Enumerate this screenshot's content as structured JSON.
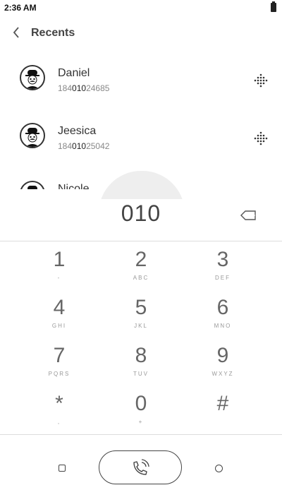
{
  "status_bar": {
    "time": "2:36 AM",
    "battery_icon": "battery-icon"
  },
  "header": {
    "title": "Recents",
    "back_icon": "back-arrow-icon"
  },
  "recents": [
    {
      "name": "Daniel",
      "number_prefix": "184",
      "number_match": "010",
      "number_suffix": "24685"
    },
    {
      "name": "Jeesica",
      "number_prefix": "184",
      "number_match": "010",
      "number_suffix": "25042"
    },
    {
      "name": "Nicole"
    }
  ],
  "dialer": {
    "input_value": "010",
    "backspace_icon": "backspace-icon"
  },
  "keypad": [
    {
      "digit": "1",
      "letters": "-"
    },
    {
      "digit": "2",
      "letters": "ABC"
    },
    {
      "digit": "3",
      "letters": "DEF"
    },
    {
      "digit": "4",
      "letters": "GHI"
    },
    {
      "digit": "5",
      "letters": "JKL"
    },
    {
      "digit": "6",
      "letters": "MNO"
    },
    {
      "digit": "7",
      "letters": "PQRS"
    },
    {
      "digit": "8",
      "letters": "TUV"
    },
    {
      "digit": "9",
      "letters": "WXYZ"
    },
    {
      "digit": "*",
      "letters": ","
    },
    {
      "digit": "0",
      "letters": "+"
    },
    {
      "digit": "#",
      "letters": ""
    }
  ],
  "bottom_bar": {
    "left_icon": "square-icon",
    "call_icon": "phone-call-icon",
    "right_icon": "circle-icon"
  }
}
